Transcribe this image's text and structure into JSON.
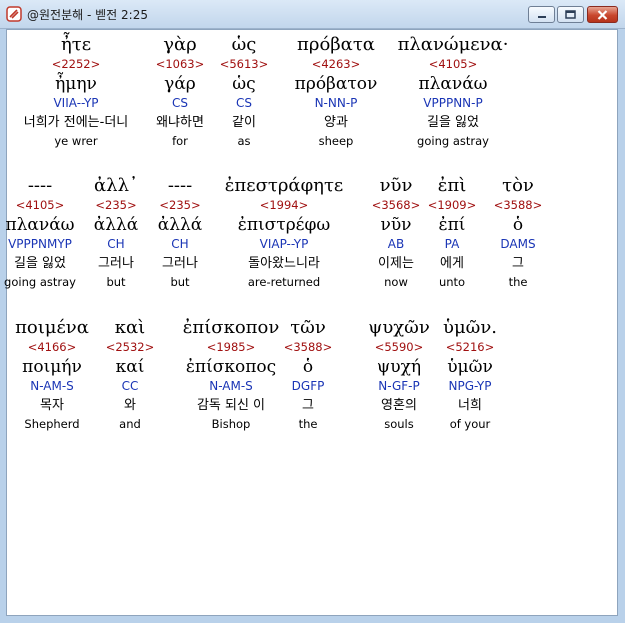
{
  "window": {
    "title": "@원전분해 - 벧전 2:25",
    "icon": "app-logo-icon",
    "buttons": {
      "minimize": "minimize-icon",
      "maximize": "maximize-icon",
      "close": "close-icon"
    }
  },
  "colors": {
    "strongs": "#a01010",
    "parsing": "#1a35b5"
  },
  "rows": [
    [
      {
        "word": "ἦτε",
        "num": "<2252>",
        "lemma": "ἦμην",
        "parse": "VIIA--YP",
        "kor": "너희가 전에는-더니",
        "eng": "ye wrer"
      },
      {
        "word": "γὰρ",
        "num": "<1063>",
        "lemma": "γάρ",
        "parse": "CS",
        "kor": "왜냐하면",
        "eng": "for"
      },
      {
        "word": "ὡς",
        "num": "<5613>",
        "lemma": "ὡς",
        "parse": "CS",
        "kor": "같이",
        "eng": "as"
      },
      {
        "word": "πρόβατα",
        "num": "<4263>",
        "lemma": "πρόβατον",
        "parse": "N-NN-P",
        "kor": "양과",
        "eng": "sheep"
      },
      {
        "word": "πλανώμενα·",
        "num": "<4105>",
        "lemma": "πλανάω",
        "parse": "VPPPNN-P",
        "kor": "길을 잃었",
        "eng": "going astray"
      }
    ],
    [
      {
        "word": "----",
        "num": "<4105>",
        "lemma": "πλανάω",
        "parse": "VPPPNMYP",
        "kor": "길을 잃었",
        "eng": "going astray"
      },
      {
        "word": "ἀλλ᾽",
        "num": "<235>",
        "lemma": "ἀλλά",
        "parse": "CH",
        "kor": "그러나",
        "eng": "but"
      },
      {
        "word": "----",
        "num": "<235>",
        "lemma": "ἀλλά",
        "parse": "CH",
        "kor": "그러나",
        "eng": "but"
      },
      {
        "word": "ἐπεστράφητε",
        "num": "<1994>",
        "lemma": "ἐπιστρέφω",
        "parse": "VIAP--YP",
        "kor": "돌아왔느니라",
        "eng": "are-returned"
      },
      {
        "word": "νῦν",
        "num": "<3568>",
        "lemma": "νῦν",
        "parse": "AB",
        "kor": "이제는",
        "eng": "now"
      },
      {
        "word": "ἐπὶ",
        "num": "<1909>",
        "lemma": "ἐπί",
        "parse": "PA",
        "kor": "에게",
        "eng": "unto"
      },
      {
        "word": "τὸν",
        "num": "<3588>",
        "lemma": "ὁ",
        "parse": "DAMS",
        "kor": "그",
        "eng": "the"
      }
    ],
    [
      {
        "word": "ποιμένα",
        "num": "<4166>",
        "lemma": "ποιμήν",
        "parse": "N-AM-S",
        "kor": "목자",
        "eng": "Shepherd"
      },
      {
        "word": "καὶ",
        "num": "<2532>",
        "lemma": "καί",
        "parse": "CC",
        "kor": "와",
        "eng": "and"
      },
      {
        "word": "ἐπίσκοπον",
        "num": "<1985>",
        "lemma": "ἐπίσκοπος",
        "parse": "N-AM-S",
        "kor": "감독 되신 이",
        "eng": "Bishop"
      },
      {
        "word": "τῶν",
        "num": "<3588>",
        "lemma": "ὁ",
        "parse": "DGFP",
        "kor": "그",
        "eng": "the"
      },
      {
        "word": "ψυχῶν",
        "num": "<5590>",
        "lemma": "ψυχή",
        "parse": "N-GF-P",
        "kor": "영혼의",
        "eng": "souls"
      },
      {
        "word": "ὑμῶν.",
        "num": "<5216>",
        "lemma": "ὑμῶν",
        "parse": "NPG-YP",
        "kor": "너희",
        "eng": "of your"
      }
    ]
  ]
}
